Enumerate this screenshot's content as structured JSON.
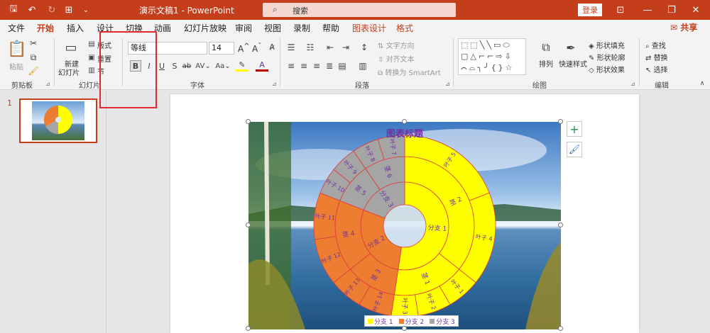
{
  "titlebar": {
    "doc_title": "演示文稿1  -  PowerPoint",
    "search_placeholder": "搜索",
    "login_label": "登录",
    "qat": [
      {
        "icon": "save-icon",
        "glyph": "🖫"
      },
      {
        "icon": "undo-icon",
        "glyph": "↶"
      },
      {
        "icon": "redo-icon",
        "glyph": "↻"
      },
      {
        "icon": "start-from-beginning-icon",
        "glyph": "⊞"
      },
      {
        "icon": "customize-qat-icon",
        "glyph": "⌄"
      }
    ],
    "window_buttons": [
      {
        "icon": "ribbon-display-icon",
        "glyph": "⊡"
      },
      {
        "icon": "minimize-icon",
        "glyph": "—"
      },
      {
        "icon": "restore-icon",
        "glyph": "❐"
      },
      {
        "icon": "close-icon",
        "glyph": "✕"
      }
    ]
  },
  "tabs": [
    "文件",
    "开始",
    "插入",
    "设计",
    "切换",
    "动画",
    "幻灯片放映",
    "审阅",
    "视图",
    "录制",
    "帮助",
    "图表设计",
    "格式"
  ],
  "active_tab": "开始",
  "share_label": "共享",
  "ribbon": {
    "clipboard": {
      "paste": "粘贴",
      "group": "剪贴板"
    },
    "slides": {
      "new_slide": "新建",
      "new_slide2": "幻灯片",
      "layout": "版式",
      "reset": "重置",
      "section": "节",
      "group": "幻灯片"
    },
    "font": {
      "font_name": "等线",
      "font_size": "14",
      "bold": "B",
      "italic": "I",
      "underline": "U",
      "strike": "S",
      "strikethrough": "ab",
      "spacing": "AV",
      "case": "Aa",
      "grow": "A",
      "shrink": "A",
      "group": "字体"
    },
    "paragraph": {
      "text_direction": "文字方向",
      "align_text": "对齐文本",
      "smartart": "转换为 SmartArt",
      "group": "段落"
    },
    "drawing": {
      "arrange": "排列",
      "quick_styles": "快速样式",
      "shape_fill": "形状填充",
      "shape_outline": "形状轮廓",
      "shape_effects": "形状效果",
      "group": "绘图"
    },
    "editing": {
      "find": "查找",
      "replace": "替换",
      "select": "选择",
      "group": "编辑"
    }
  },
  "thumb": {
    "number": "1"
  },
  "chart_data": {
    "type": "sunburst",
    "title": "图表标题",
    "colors": {
      "分支 1": "#ffff00",
      "分支 2": "#ed7d31",
      "分支 3": "#a5a5a5"
    },
    "legend": [
      "分支 1",
      "分支 2",
      "分支 3"
    ],
    "rings": [
      [
        {
          "label": "分支 1",
          "branch": "分支 1",
          "value": 22
        },
        {
          "label": "分支 2",
          "branch": "分支 2",
          "value": 12
        },
        {
          "label": "分支 3",
          "branch": "分支 3",
          "value": 8
        }
      ],
      [
        {
          "label": "茎 2",
          "branch": "分支 1",
          "value": 15
        },
        {
          "label": "茎 1",
          "branch": "分支 1",
          "value": 7
        },
        {
          "label": "茎 3",
          "branch": "分支 2",
          "value": 5
        },
        {
          "label": "茎 4",
          "branch": "分支 2",
          "value": 7
        },
        {
          "label": "茎 5",
          "branch": "分支 3",
          "value": 4
        },
        {
          "label": "茎 6",
          "branch": "分支 3",
          "value": 4
        }
      ],
      [
        {
          "label": "叶子 5",
          "branch": "分支 1",
          "value": 8
        },
        {
          "label": "叶子 4",
          "branch": "分支 1",
          "value": 7
        },
        {
          "label": "叶子 1",
          "branch": "分支 1",
          "value": 2.5
        },
        {
          "label": "叶子 2",
          "branch": "分支 1",
          "value": 2.5
        },
        {
          "label": "叶子 3",
          "branch": "分支 1",
          "value": 2
        },
        {
          "label": "叶子 14",
          "branch": "分支 2",
          "value": 2.5
        },
        {
          "label": "叶子 13",
          "branch": "分支 2",
          "value": 2.5
        },
        {
          "label": "叶子 12",
          "branch": "分支 2",
          "value": 3.5
        },
        {
          "label": "叶子 11",
          "branch": "分支 2",
          "value": 3.5
        },
        {
          "label": "叶子 10",
          "branch": "分支 3",
          "value": 2
        },
        {
          "label": "叶子 9",
          "branch": "分支 3",
          "value": 2
        },
        {
          "label": "叶子 8",
          "branch": "分支 3",
          "value": 2
        },
        {
          "label": "叶子 7",
          "branch": "分支 3",
          "value": 2
        }
      ]
    ]
  }
}
